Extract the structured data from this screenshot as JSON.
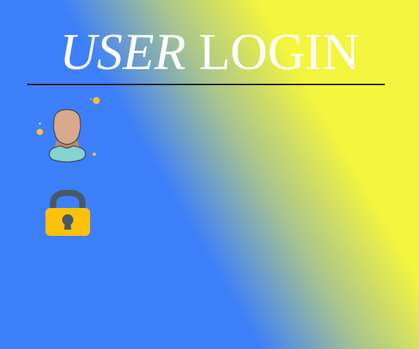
{
  "header": {
    "title_part1": "USER",
    "title_part2": "LOGIN"
  },
  "form": {
    "username_icon": "user-avatar-icon",
    "password_icon": "padlock-icon"
  },
  "colors": {
    "gradient_blue": "#3d7ff9",
    "gradient_yellow": "#f3f53e",
    "title": "#ffffff",
    "lock_body": "#fcc10a",
    "lock_shackle": "#465a66"
  }
}
